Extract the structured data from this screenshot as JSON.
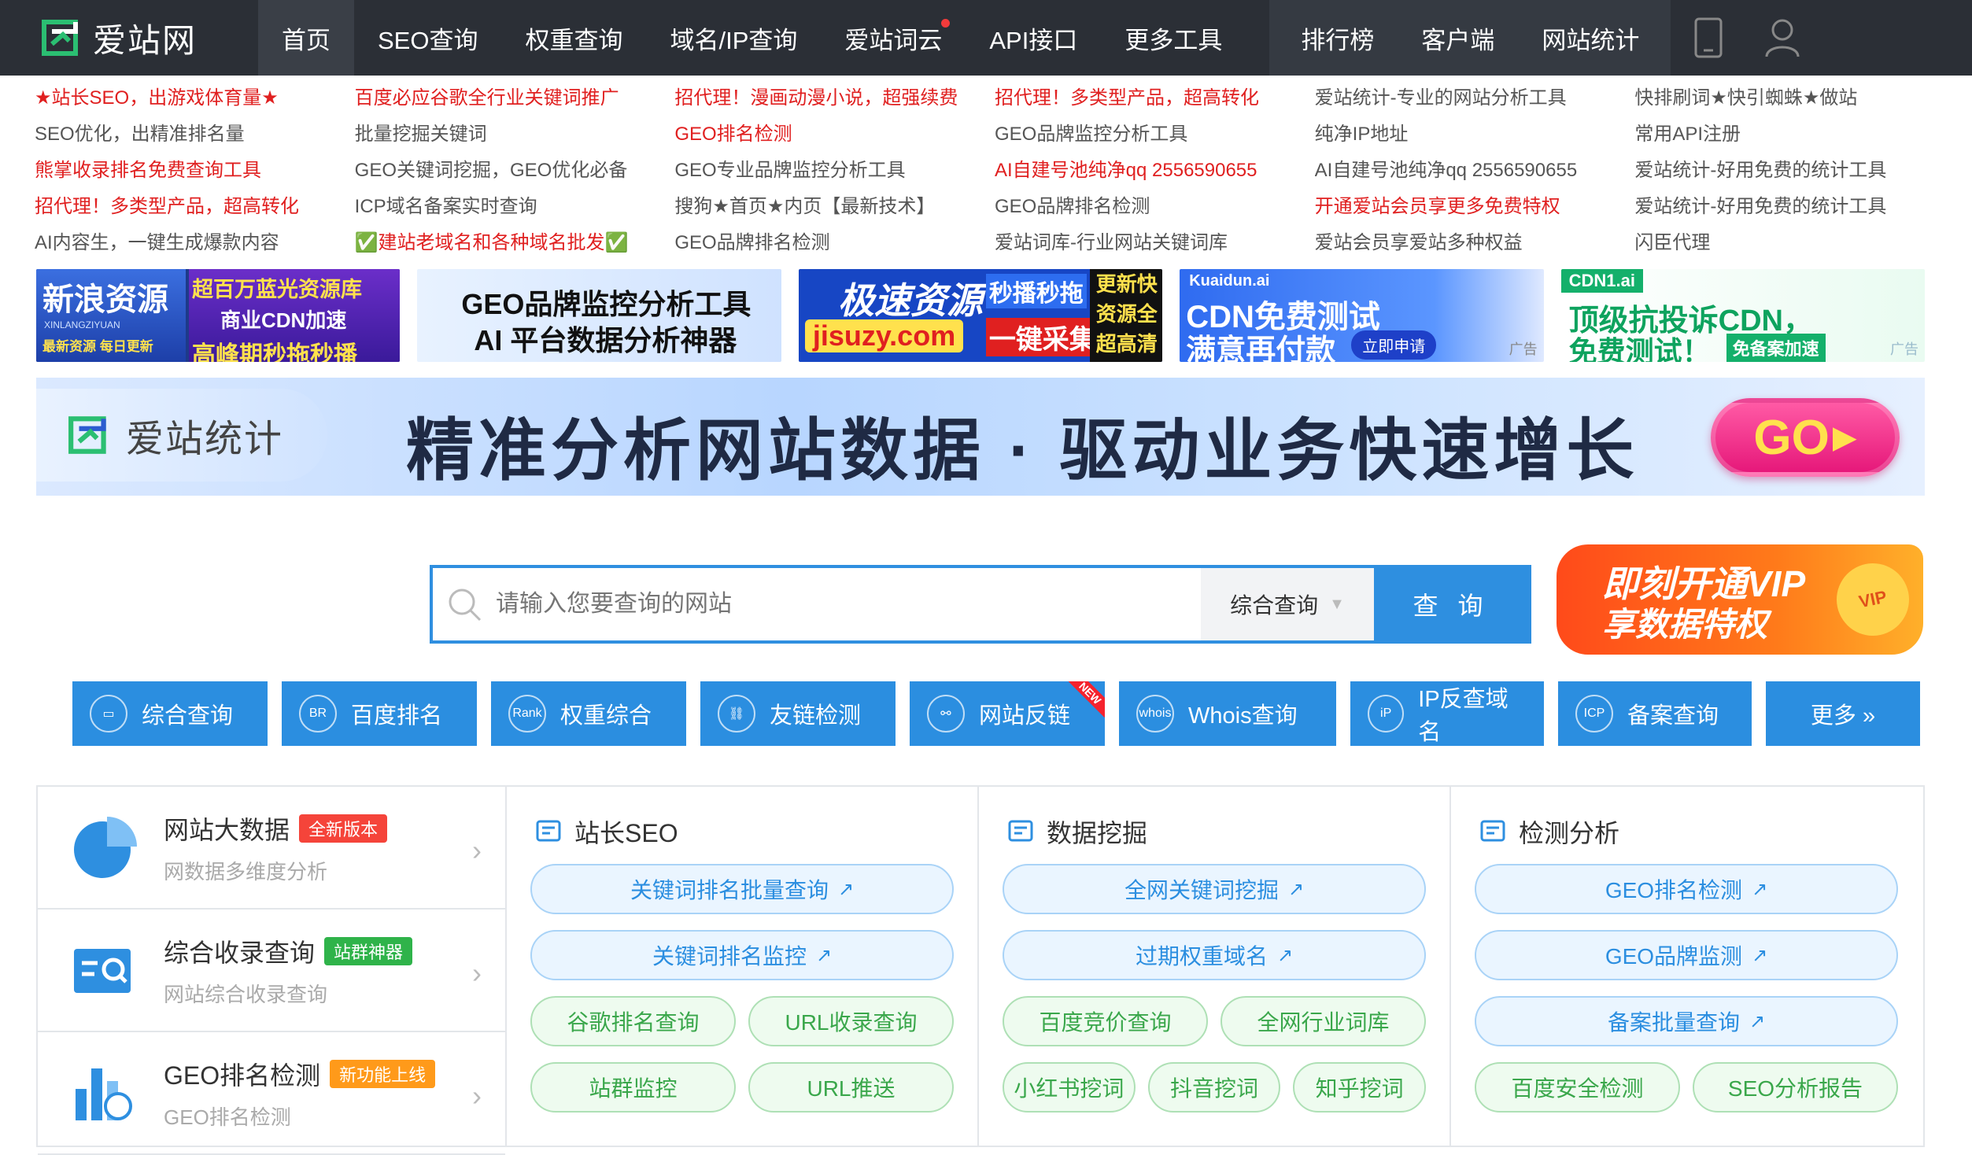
{
  "brand": {
    "name": "爱站网"
  },
  "nav": {
    "items": [
      "首页",
      "SEO查询",
      "权重查询",
      "域名/IP查询",
      "爱站词云",
      "API接口",
      "更多工具"
    ],
    "group": [
      "排行榜",
      "客户端",
      "网站统计"
    ]
  },
  "links": [
    {
      "text": "★站长SEO，出游戏体育量★",
      "color": "#e02020"
    },
    {
      "text": "百度必应谷歌全行业关键词推广",
      "color": "#e02020"
    },
    {
      "text": "招代理！漫画动漫小说，超强续费",
      "color": "#e02020"
    },
    {
      "text": "招代理！多类型产品，超高转化",
      "color": "#e02020"
    },
    {
      "text": "爱站统计-专业的网站分析工具",
      "color": "#555555"
    },
    {
      "text": "快排刷词★快引蜘蛛★做站",
      "color": "#555555"
    },
    {
      "text": "SEO优化，出精准排名量",
      "color": "#555555"
    },
    {
      "text": "批量挖掘关键词",
      "color": "#555555"
    },
    {
      "text": "GEO排名检测",
      "color": "#e02020"
    },
    {
      "text": "GEO品牌监控分析工具",
      "color": "#555555"
    },
    {
      "text": "纯净IP地址",
      "color": "#555555"
    },
    {
      "text": "常用API注册",
      "color": "#555555"
    },
    {
      "text": "熊掌收录排名免费查询工具",
      "color": "#e02020"
    },
    {
      "text": "GEO关键词挖掘，GEO优化必备",
      "color": "#555555"
    },
    {
      "text": "GEO专业品牌监控分析工具",
      "color": "#555555"
    },
    {
      "text": "AI自建号池纯净qq 2556590655",
      "color": "#e02020"
    },
    {
      "text": "AI自建号池纯净qq 2556590655",
      "color": "#555555"
    },
    {
      "text": "爱站统计-好用免费的统计工具",
      "color": "#555555"
    },
    {
      "text": "招代理！多类型产品，超高转化",
      "color": "#e02020"
    },
    {
      "text": "ICP域名备案实时查询",
      "color": "#555555"
    },
    {
      "text": "搜狗★首页★内页【最新技术】",
      "color": "#555555"
    },
    {
      "text": "GEO品牌排名检测",
      "color": "#555555"
    },
    {
      "text": "开通爱站会员享更多免费特权",
      "color": "#e02020"
    },
    {
      "text": "爱站统计-好用免费的统计工具",
      "color": "#555555"
    },
    {
      "text": "AI内容生，一键生成爆款内容",
      "color": "#555555"
    },
    {
      "text": "✅建站老域名和各种域名批发✅",
      "color": "#e02020"
    },
    {
      "text": "GEO品牌排名检测",
      "color": "#555555"
    },
    {
      "text": "爱站词库-行业网站关键词库",
      "color": "#555555"
    },
    {
      "text": "爱站会员享爱站多种权益",
      "color": "#555555"
    },
    {
      "text": "闪臣代理",
      "color": "#555555"
    }
  ],
  "ads": [
    {
      "l1": "新浪资源",
      "l2": "超百万蓝光资源库",
      "l3": "商业CDN加速",
      "l4": "最新资源 每日更新",
      "l5": "高峰期秒拖秒播",
      "sub": "XINLANGZIYUAN"
    },
    {
      "l1": "GEO品牌监控分析工具",
      "l2": "AI 平台数据分析神器"
    },
    {
      "l1": "极速资源",
      "l2": "jisuzy.com",
      "l3": "秒播秒拖",
      "l4": "一键采集",
      "l5": "更新快",
      "l6": "资源全",
      "l7": "超高清"
    },
    {
      "l1": "Kuaidun.ai",
      "l2": "CDN免费测试",
      "l3": "满意再付款",
      "l4": "立即申请",
      "l5": "广告"
    },
    {
      "l1": "CDN1.ai",
      "l2": "顶级抗投诉CDN，",
      "l3": "免费测试！",
      "l4": "免备案加速",
      "l5": "广告"
    }
  ],
  "banner": {
    "logo": "爱站统计",
    "headline": "精准分析网站数据 · 驱动业务快速增长",
    "go": "GO"
  },
  "search": {
    "placeholder": "请输入您要查询的网站",
    "select": "综合查询",
    "button": "查 询"
  },
  "vip": {
    "line1": "即刻开通VIP",
    "line2": "享数据特权",
    "badge": "VIP"
  },
  "tools": [
    {
      "label": "综合查询",
      "icon": "monitor-icon",
      "glyph": "▭"
    },
    {
      "label": "百度排名",
      "icon": "paw-icon",
      "glyph": "BR"
    },
    {
      "label": "权重综合",
      "icon": "rank-icon",
      "glyph": "Rank"
    },
    {
      "label": "友链检测",
      "icon": "link-icon",
      "glyph": "⛓"
    },
    {
      "label": "网站反链",
      "icon": "backlink-icon",
      "glyph": "⚯",
      "badge": "NEW"
    },
    {
      "label": "Whois查询",
      "icon": "whois-icon",
      "glyph": "whois"
    },
    {
      "label": "IP反查域名",
      "icon": "ip-icon",
      "glyph": "iP"
    },
    {
      "label": "备案查询",
      "icon": "icp-icon",
      "glyph": "ICP"
    },
    {
      "label": "更多 »",
      "icon": "more-icon",
      "glyph": ""
    }
  ],
  "left_items": [
    {
      "title": "网站大数据",
      "tag": "全新版本",
      "tag_color": "#f5443a",
      "sub": "网数据多维度分析"
    },
    {
      "title": "综合收录查询",
      "tag": "站群神器",
      "tag_color": "#2fb34a",
      "sub": "网站综合收录查询"
    },
    {
      "title": "GEO排名检测",
      "tag": "新功能上线",
      "tag_color": "#ff9a1a",
      "sub": "GEO排名检测"
    }
  ],
  "columns": [
    {
      "title": "站长SEO",
      "full": [
        "关键词排名批量查询",
        "关键词排名监控"
      ],
      "rows": [
        [
          "谷歌排名查询",
          "URL收录查询"
        ],
        [
          "站群监控",
          "URL推送"
        ]
      ]
    },
    {
      "title": "数据挖掘",
      "full": [
        "全网关键词挖掘",
        "过期权重域名"
      ],
      "rows": [
        [
          "百度竞价查询",
          "全网行业词库"
        ],
        [
          "小红书挖词",
          "抖音挖词",
          "知乎挖词"
        ]
      ]
    },
    {
      "title": "检测分析",
      "full": [
        "GEO排名检测",
        "GEO品牌监测",
        "备案批量查询"
      ],
      "rows": [
        [
          "百度安全检测",
          "SEO分析报告"
        ]
      ]
    }
  ]
}
